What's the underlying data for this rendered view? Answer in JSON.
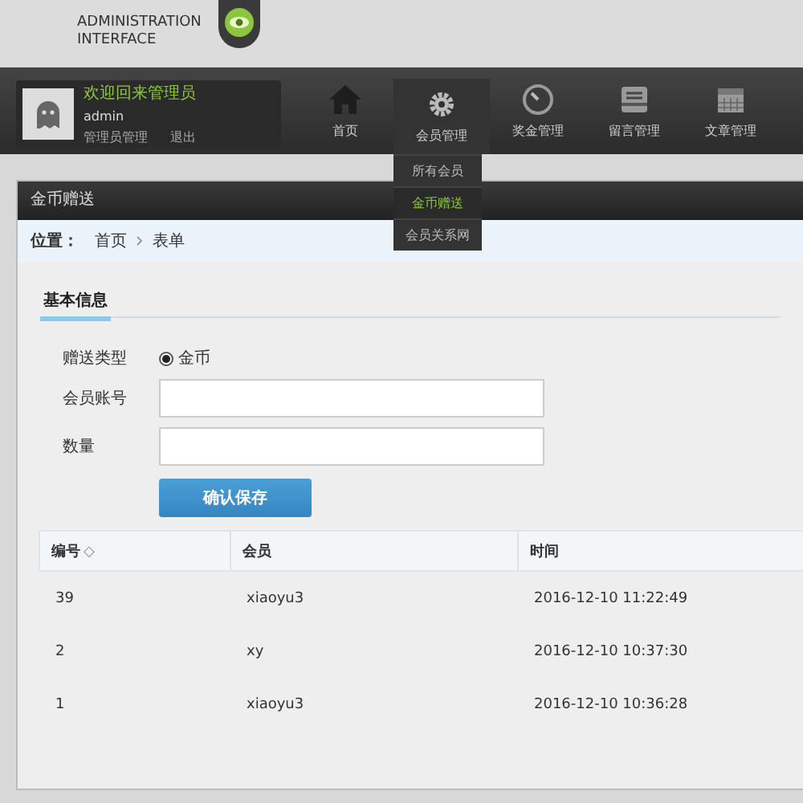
{
  "header": {
    "title_line1": "ADMINISTRATION",
    "title_line2": "INTERFACE"
  },
  "user": {
    "welcome": "欢迎回来管理员",
    "name": "admin",
    "links": [
      "管理员管理",
      "退出"
    ]
  },
  "nav": [
    {
      "label": "首页",
      "selected": false
    },
    {
      "label": "会员管理",
      "selected": true,
      "menu": [
        {
          "label": "所有会员",
          "selected": false
        },
        {
          "label": "金币赠送",
          "selected": true
        },
        {
          "label": "会员关系网",
          "selected": false
        }
      ]
    },
    {
      "label": "奖金管理",
      "selected": false
    },
    {
      "label": "留言管理",
      "selected": false
    },
    {
      "label": "文章管理",
      "selected": false
    }
  ],
  "panel": {
    "title": "金币赠送",
    "breadcrumb_label": "位置：",
    "breadcrumb": [
      "首页",
      "表单"
    ],
    "tab": "基本信息"
  },
  "form": {
    "type_label": "赠送类型",
    "type_option": {
      "label": "金币",
      "checked": true
    },
    "account_label": "会员账号",
    "amount_label": "数量",
    "submit": "确认保存"
  },
  "table": {
    "columns": [
      "编号",
      "会员",
      "时间"
    ],
    "sort_icon": "◇",
    "rows": [
      [
        "39",
        "xiaoyu3",
        "2016-12-10 11:22:49"
      ],
      [
        "2",
        "xy",
        "2016-12-10 10:37:30"
      ],
      [
        "1",
        "xiaoyu3",
        "2016-12-10 10:36:28"
      ]
    ]
  }
}
